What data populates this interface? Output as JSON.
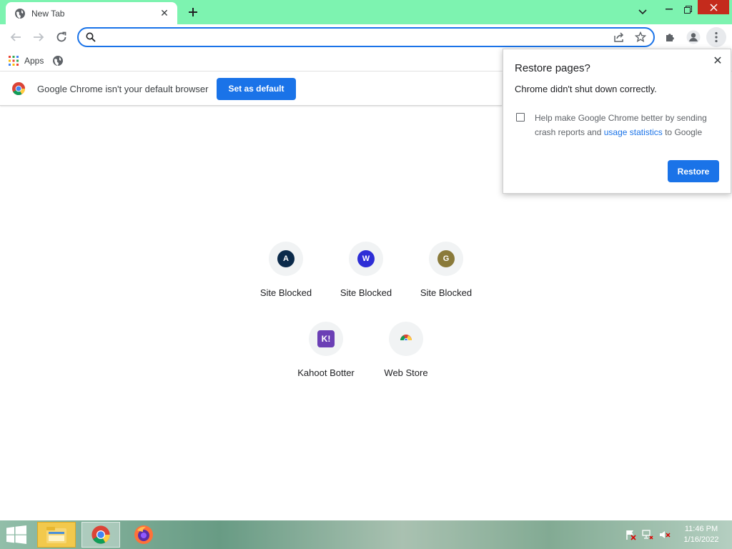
{
  "tab": {
    "title": "New Tab"
  },
  "omnibox": {
    "value": "",
    "placeholder": ""
  },
  "bookmarks": {
    "apps_label": "Apps"
  },
  "infobar": {
    "message": "Google Chrome isn't your default browser",
    "button": "Set as default"
  },
  "restore_dialog": {
    "title": "Restore pages?",
    "subtitle": "Chrome didn't shut down correctly.",
    "checkbox_text_before": "Help make Google Chrome better by sending crash reports and ",
    "checkbox_link": "usage statistics",
    "checkbox_text_after": " to Google",
    "button": "Restore"
  },
  "shortcuts": [
    {
      "label": "Site Blocked",
      "letter": "A",
      "color": "#0b2a4a"
    },
    {
      "label": "Site Blocked",
      "letter": "W",
      "color": "#2e2ed6"
    },
    {
      "label": "Site Blocked",
      "letter": "G",
      "color": "#8a7a3a"
    },
    {
      "label": "Kahoot Botter",
      "letter": "K!",
      "color": "#6b3fb5"
    },
    {
      "label": "Web Store",
      "letter": "",
      "color": "#f1f3f4"
    }
  ],
  "taskbar": {
    "time": "11:46 PM",
    "date": "1/16/2022"
  },
  "colors": {
    "tabstrip": "#7df3b0",
    "accent": "#1a73e8",
    "close": "#c42b1c"
  }
}
